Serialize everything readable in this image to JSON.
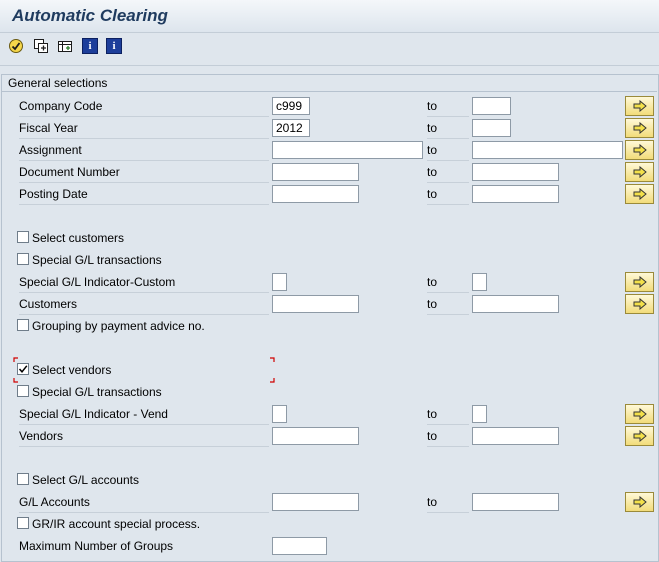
{
  "title": "Automatic Clearing",
  "toolbar": {
    "icons": [
      "execute-icon",
      "variant-icon",
      "dynamic-selection-icon",
      "info-icon",
      "info-icon"
    ]
  },
  "panel": {
    "title": "General selections",
    "to_label": "to"
  },
  "fields": {
    "company_code": {
      "label": "Company Code",
      "from": "c999",
      "to": ""
    },
    "fiscal_year": {
      "label": "Fiscal Year",
      "from": "2012",
      "to": ""
    },
    "assignment": {
      "label": "Assignment",
      "from": "",
      "to": ""
    },
    "document_number": {
      "label": "Document Number",
      "from": "",
      "to": ""
    },
    "posting_date": {
      "label": "Posting Date",
      "from": "",
      "to": ""
    },
    "select_customers": {
      "label": "Select customers",
      "checked": false
    },
    "special_gl_customers": {
      "label": "Special G/L transactions",
      "checked": false
    },
    "special_gl_indicator_custom": {
      "label": "Special G/L Indicator-Custom",
      "from": "",
      "to": ""
    },
    "customers": {
      "label": "Customers",
      "from": "",
      "to": ""
    },
    "grouping_payment_advice": {
      "label": "Grouping by payment advice no.",
      "checked": false
    },
    "select_vendors": {
      "label": "Select vendors",
      "checked": true
    },
    "special_gl_vendors": {
      "label": "Special G/L transactions",
      "checked": false
    },
    "special_gl_indicator_vend": {
      "label": "Special G/L Indicator - Vend",
      "from": "",
      "to": ""
    },
    "vendors": {
      "label": "Vendors",
      "from": "",
      "to": ""
    },
    "select_gl_accounts": {
      "label": "Select G/L accounts",
      "checked": false
    },
    "gl_accounts": {
      "label": "G/L Accounts",
      "from": "",
      "to": ""
    },
    "grir_special_process": {
      "label": "GR/IR account special process.",
      "checked": false
    },
    "max_groups": {
      "label": "Maximum Number of Groups",
      "value": ""
    }
  },
  "colors": {
    "background": "#dfe6ed",
    "title": "#1f3b5f",
    "arrow_button": "#f2dc7a",
    "focus_marker": "#d00000"
  }
}
